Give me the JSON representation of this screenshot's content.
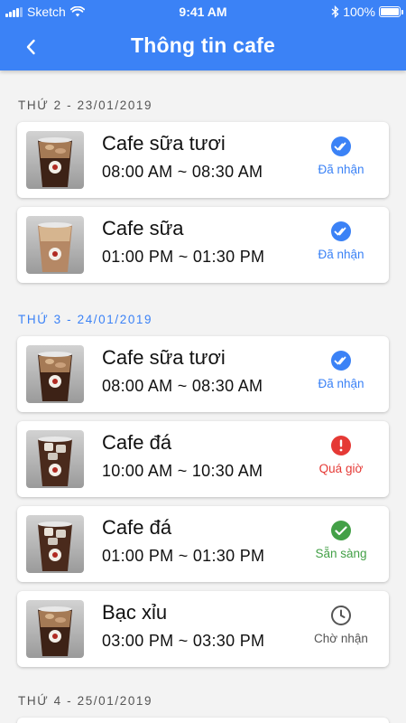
{
  "status_bar": {
    "carrier": "Sketch",
    "time": "9:41 AM",
    "battery": "100%"
  },
  "header": {
    "title": "Thông tin cafe"
  },
  "colors": {
    "primary": "#3b82f6",
    "received": "#3b82f6",
    "overdue": "#e53935",
    "ready": "#43a047",
    "waiting": "#555555"
  },
  "days": [
    {
      "label": "THỨ 2 - 23/01/2019"
    },
    {
      "label": "THỨ 3 - 24/01/2019"
    },
    {
      "label": "THỨ 4 - 25/01/2019"
    }
  ],
  "orders": [
    {
      "name": "Cafe sữa tươi",
      "time": "08:00 AM ~ 08:30 AM",
      "status": "Đã nhận",
      "status_icon": "double-check-icon"
    },
    {
      "name": "Cafe sữa",
      "time": "01:00 PM ~ 01:30 PM",
      "status": "Đã nhận",
      "status_icon": "double-check-icon"
    },
    {
      "name": "Cafe sữa tươi",
      "time": "08:00 AM ~ 08:30 AM",
      "status": "Đã nhận",
      "status_icon": "double-check-icon"
    },
    {
      "name": "Cafe đá",
      "time": "10:00 AM ~ 10:30 AM",
      "status": "Quá giờ",
      "status_icon": "alert-icon"
    },
    {
      "name": "Cafe đá",
      "time": "01:00 PM ~ 01:30 PM",
      "status": "Sẵn sàng",
      "status_icon": "check-circle-icon"
    },
    {
      "name": "Bạc xỉu",
      "time": "03:00 PM ~ 03:30 PM",
      "status": "Chờ nhận",
      "status_icon": "clock-icon"
    }
  ]
}
